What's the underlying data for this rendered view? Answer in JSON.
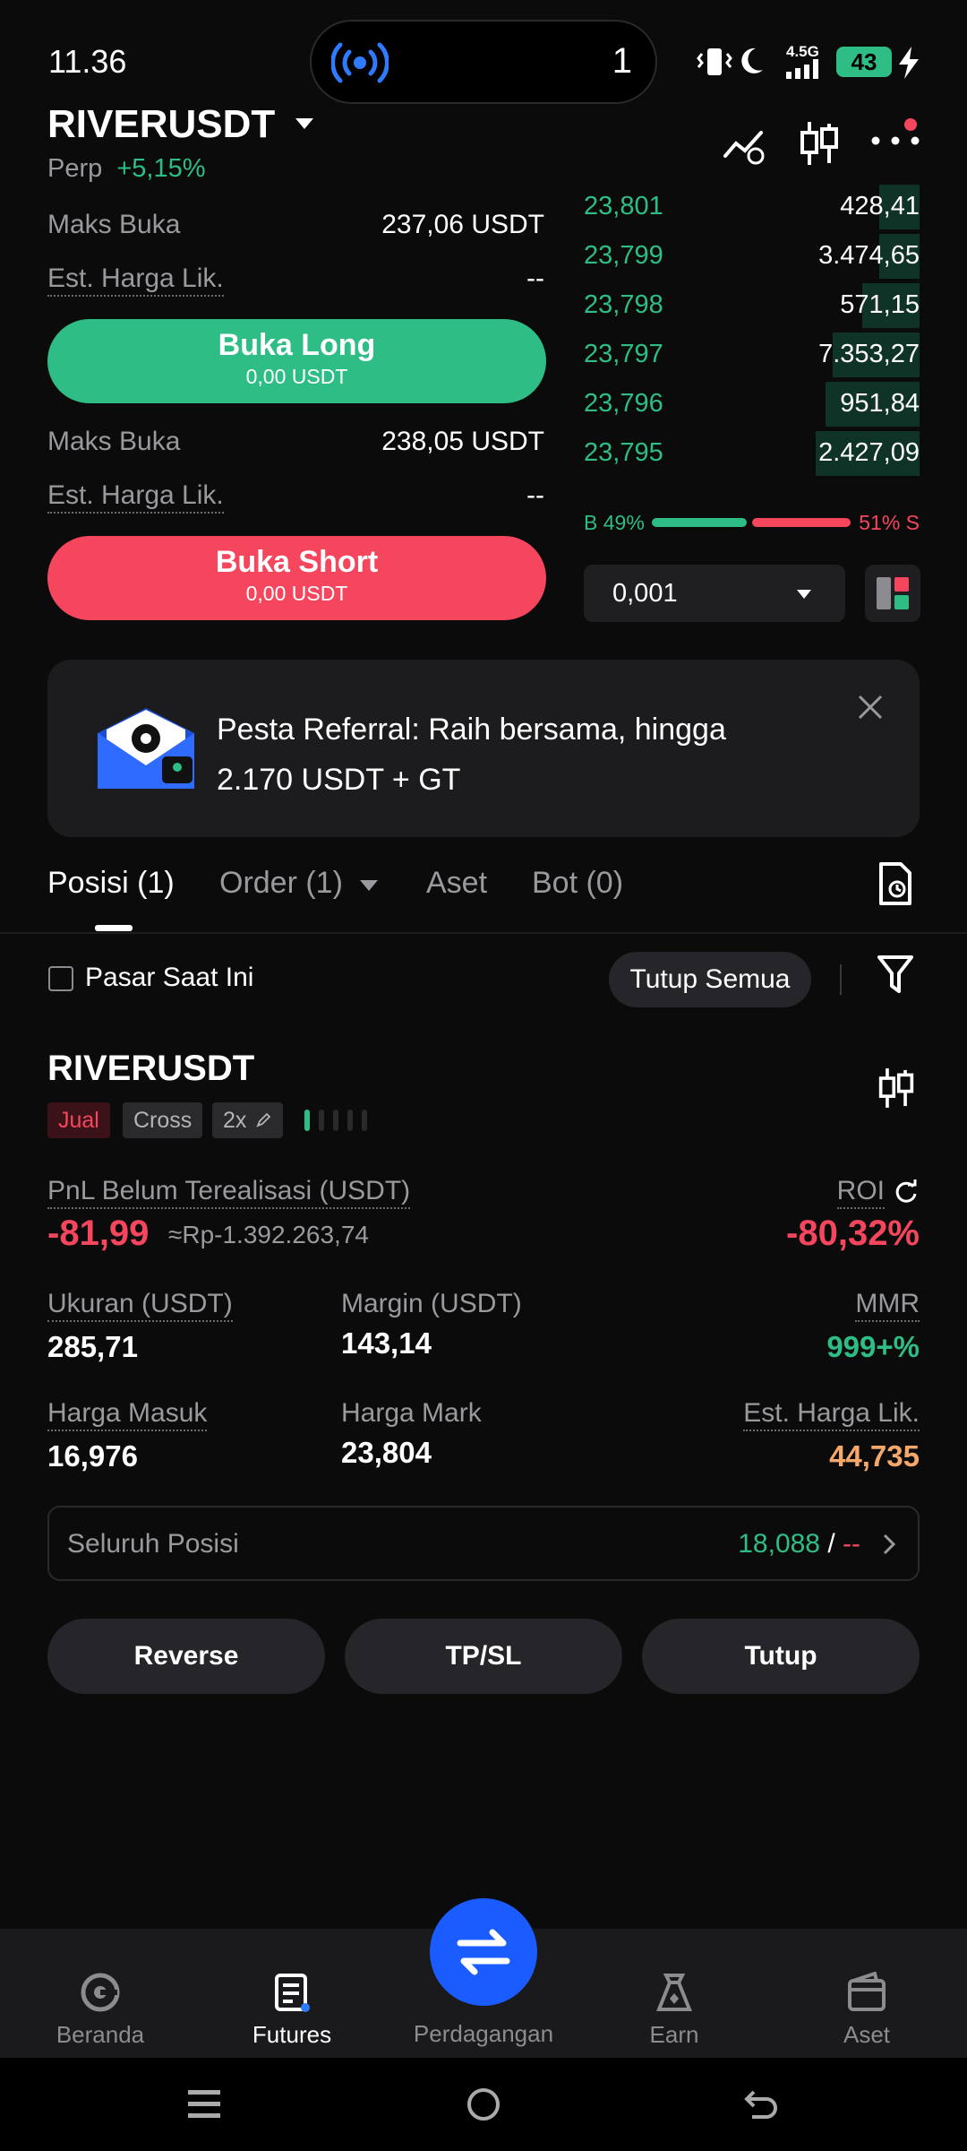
{
  "status": {
    "time": "11.36",
    "pill_count": "1",
    "network": "4.5G",
    "battery": "43"
  },
  "header": {
    "symbol": "RIVERUSDT",
    "type": "Perp",
    "change": "+5,15%"
  },
  "long_panel": {
    "max_open_label": "Maks Buka",
    "max_open_value": "237,06 USDT",
    "liq_label": "Est. Harga Lik.",
    "liq_value": "--",
    "button_label": "Buka Long",
    "button_sub": "0,00 USDT"
  },
  "short_panel": {
    "max_open_label": "Maks Buka",
    "max_open_value": "238,05 USDT",
    "liq_label": "Est. Harga Lik.",
    "liq_value": "--",
    "button_label": "Buka Short",
    "button_sub": "0,00 USDT"
  },
  "orderbook": {
    "rows": [
      {
        "price": "23,801",
        "qty": "428,41",
        "depth": 0.12
      },
      {
        "price": "23,799",
        "qty": "3.474,65",
        "depth": 0.12
      },
      {
        "price": "23,798",
        "qty": "571,15",
        "depth": 0.17
      },
      {
        "price": "23,797",
        "qty": "7.353,27",
        "depth": 0.26
      },
      {
        "price": "23,796",
        "qty": "951,84",
        "depth": 0.28
      },
      {
        "price": "23,795",
        "qty": "2.427,09",
        "depth": 0.31
      }
    ],
    "buy_ratio": "B 49%",
    "sell_ratio": "51% S",
    "buy_fraction": 0.49,
    "precision": "0,001"
  },
  "banner": {
    "text_line1": "Pesta Referral: Raih bersama, hingga",
    "text_line2": "2.170 USDT + GT"
  },
  "tabs": {
    "positions": "Posisi (1)",
    "orders": "Order (1)",
    "assets": "Aset",
    "bots": "Bot (0)"
  },
  "filter_bar": {
    "checkbox_label": "Pasar Saat Ini",
    "close_all": "Tutup Semua"
  },
  "position": {
    "symbol": "RIVERUSDT",
    "side": "Jual",
    "margin_mode": "Cross",
    "leverage": "2x",
    "pnl_label": "PnL Belum Terealisasi (USDT)",
    "pnl_value": "-81,99",
    "pnl_idr": "≈Rp-1.392.263,74",
    "roi_label": "ROI",
    "roi_value": "-80,32%",
    "size_label": "Ukuran (USDT)",
    "size_value": "285,71",
    "margin_label": "Margin (USDT)",
    "margin_value": "143,14",
    "mmr_label": "MMR",
    "mmr_value": "999+%",
    "entry_label": "Harga Masuk",
    "entry_value": "16,976",
    "mark_label": "Harga Mark",
    "mark_value": "23,804",
    "liq_label": "Est. Harga Lik.",
    "liq_value": "44,735",
    "all_positions_label": "Seluruh Posisi",
    "all_positions_value": "18,088",
    "all_positions_sep": " / ",
    "all_positions_extra": "--",
    "btn_reverse": "Reverse",
    "btn_tpsl": "TP/SL",
    "btn_close": "Tutup"
  },
  "bottom_nav": {
    "home": "Beranda",
    "futures": "Futures",
    "trade": "Perdagangan",
    "earn": "Earn",
    "assets": "Aset"
  }
}
